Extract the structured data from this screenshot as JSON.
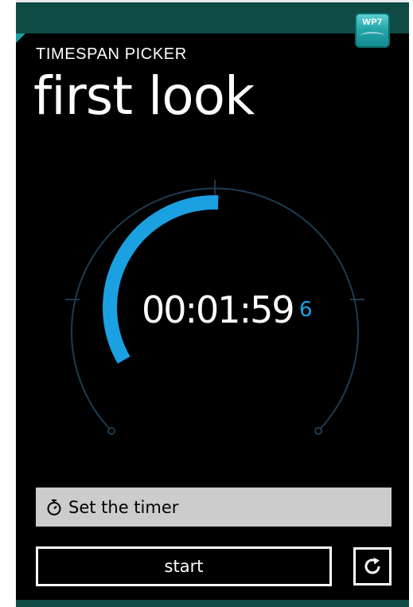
{
  "app": {
    "title": "TIMESPAN PICKER",
    "page_title": "first look",
    "badge": "WP7"
  },
  "timer": {
    "time": "00:01:59",
    "tenths": "6",
    "progress_fraction": 0.33
  },
  "set_timer": {
    "label": "Set the timer",
    "icon": "stopwatch-icon"
  },
  "actions": {
    "start_label": "start",
    "reset_icon": "refresh-icon"
  },
  "colors": {
    "accent": "#1ba1e2",
    "header": "#0f4a45",
    "background": "#000000",
    "field": "#cccccc",
    "dial_track": "#1c3c52"
  }
}
